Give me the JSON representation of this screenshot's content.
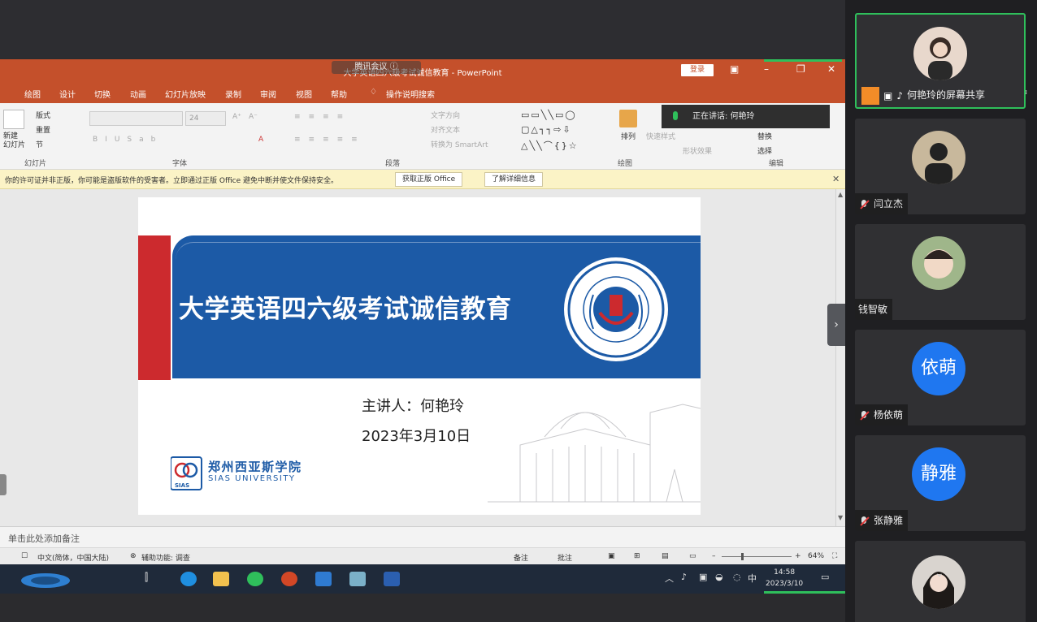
{
  "meeting": {
    "pill_text": "腾讯会议 ⓘ",
    "chat_icon": "chat-icon"
  },
  "ppt": {
    "window_title": "大学英语四六级考试诚信教育 - PowerPoint",
    "login_label": "登录",
    "tabs": [
      "绘图",
      "设计",
      "切换",
      "动画",
      "幻灯片放映",
      "录制",
      "审阅",
      "视图",
      "帮助",
      "操作说明搜索"
    ],
    "ribbon": {
      "new_slide": "新建\n幻灯片",
      "layout": "版式",
      "reset": "重置",
      "section": "节",
      "group_slides": "幻灯片",
      "font_size": "24",
      "group_font": "字体",
      "text_direction": "文字方向",
      "align_text": "对齐文本",
      "smartart": "转换为 SmartArt",
      "group_paragraph": "段落",
      "arrange": "排列",
      "quick_styles": "快速样式",
      "shape_effects": "形状效果",
      "group_drawing": "绘图",
      "replace": "替换",
      "select": "选择",
      "group_editing": "编辑"
    },
    "speaking": "正在讲话: 何艳玲",
    "notice": {
      "message": "你的许可证并非正版，你可能是盗版软件的受害者。立即通过正版 Office 避免中断并使文件保持安全。",
      "get_genuine": "获取正版 Office",
      "learn_more": "了解详细信息"
    },
    "slide": {
      "title": "大学英语四六级考试诚信教育",
      "presenter": "主讲人：何艳玲",
      "date": "2023年3月10日",
      "university_cn": "郑州西亚斯学院",
      "university_en": "SIAS UNIVERSITY",
      "logo_abbr": "SIAS"
    },
    "notes_placeholder": "单击此处添加备注",
    "status": {
      "language": "中文(简体，中国大陆)",
      "accessibility": "辅助功能: 调查",
      "notes": "备注",
      "comments": "批注",
      "zoom": "64%"
    }
  },
  "taskbar": {
    "tray_language": "中",
    "time": "14:58",
    "date": "2023/3/10"
  },
  "participants": [
    {
      "name": "何艳玲的屏幕共享",
      "type": "photo",
      "active": true
    },
    {
      "name": "闫立杰",
      "type": "photo",
      "muted": true
    },
    {
      "name": "钱智敏",
      "type": "photo",
      "muted": false
    },
    {
      "name": "杨依萌",
      "type": "text",
      "avatar_text": "依萌",
      "muted": true
    },
    {
      "name": "张静雅",
      "type": "text",
      "avatar_text": "静雅",
      "muted": true
    },
    {
      "name": "",
      "type": "photo"
    }
  ],
  "colors": {
    "ppt_brand": "#c4502b",
    "slide_blue": "#1c5aa6",
    "slide_red": "#cc2a2e",
    "avatar_blue": "#1f77f0",
    "active_green": "#2fbf5b"
  }
}
